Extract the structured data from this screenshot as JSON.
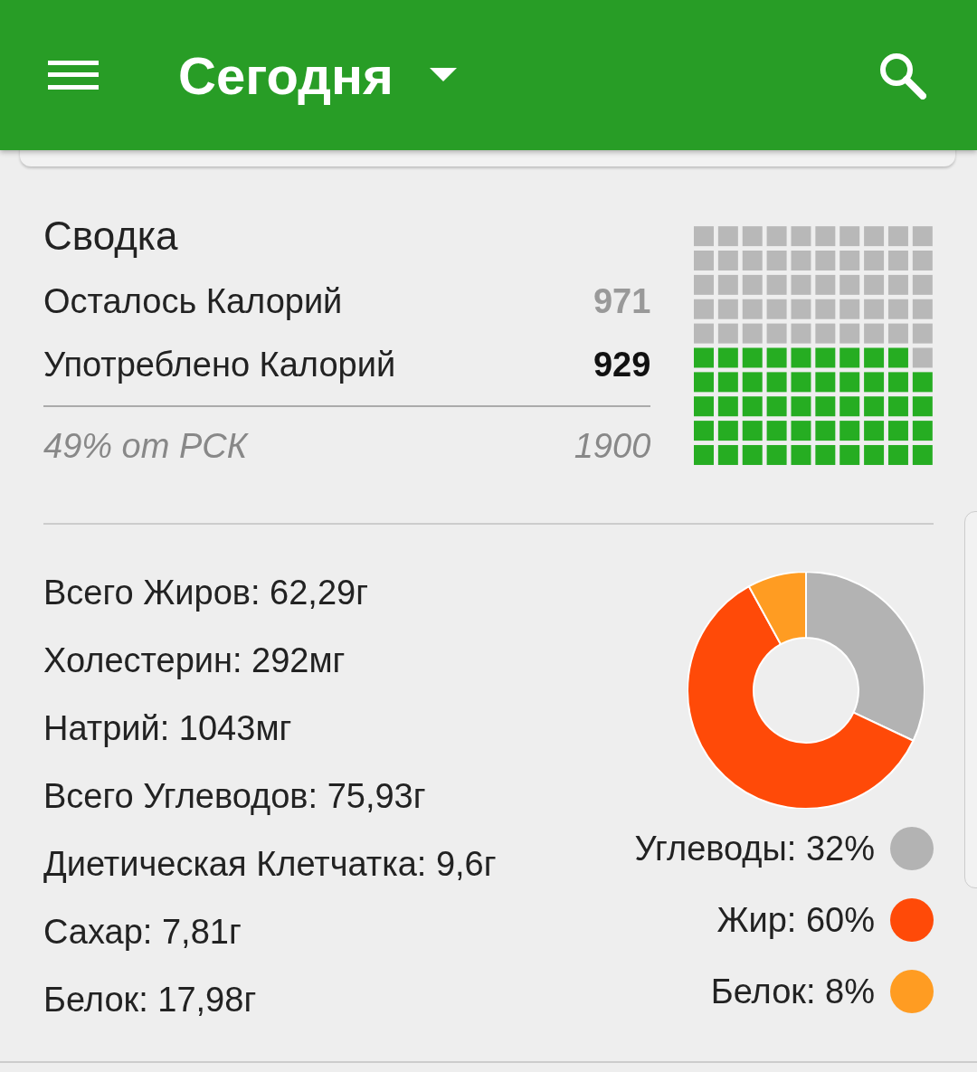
{
  "app_bar": {
    "title": "Сегодня"
  },
  "summary": {
    "heading": "Сводка",
    "rows": [
      {
        "label": "Осталось Калорий",
        "value": "971",
        "kind": "muted"
      },
      {
        "label": "Употреблено Калорий",
        "value": "929",
        "kind": "bold"
      }
    ],
    "footer_label": "49% от РСК",
    "footer_value": "1900"
  },
  "nutrients": [
    "Всего Жиров: 62,29г",
    "Холестерин: 292мг",
    "Натрий: 1043мг",
    "Всего Углеводов: 75,93г",
    "Диетическая Клетчатка: 9,6г",
    "Сахар: 7,81г",
    "Белок: 17,98г"
  ],
  "macros": {
    "chart_data": {
      "type": "donut",
      "values": [
        32,
        60,
        8
      ]
    },
    "legend": [
      {
        "label": "Углеводы: 32%",
        "color": "#b3b3b3"
      },
      {
        "label": "Жир: 60%",
        "color": "#ff4a08"
      },
      {
        "label": "Белок: 8%",
        "color": "#ff9c22"
      }
    ]
  }
}
